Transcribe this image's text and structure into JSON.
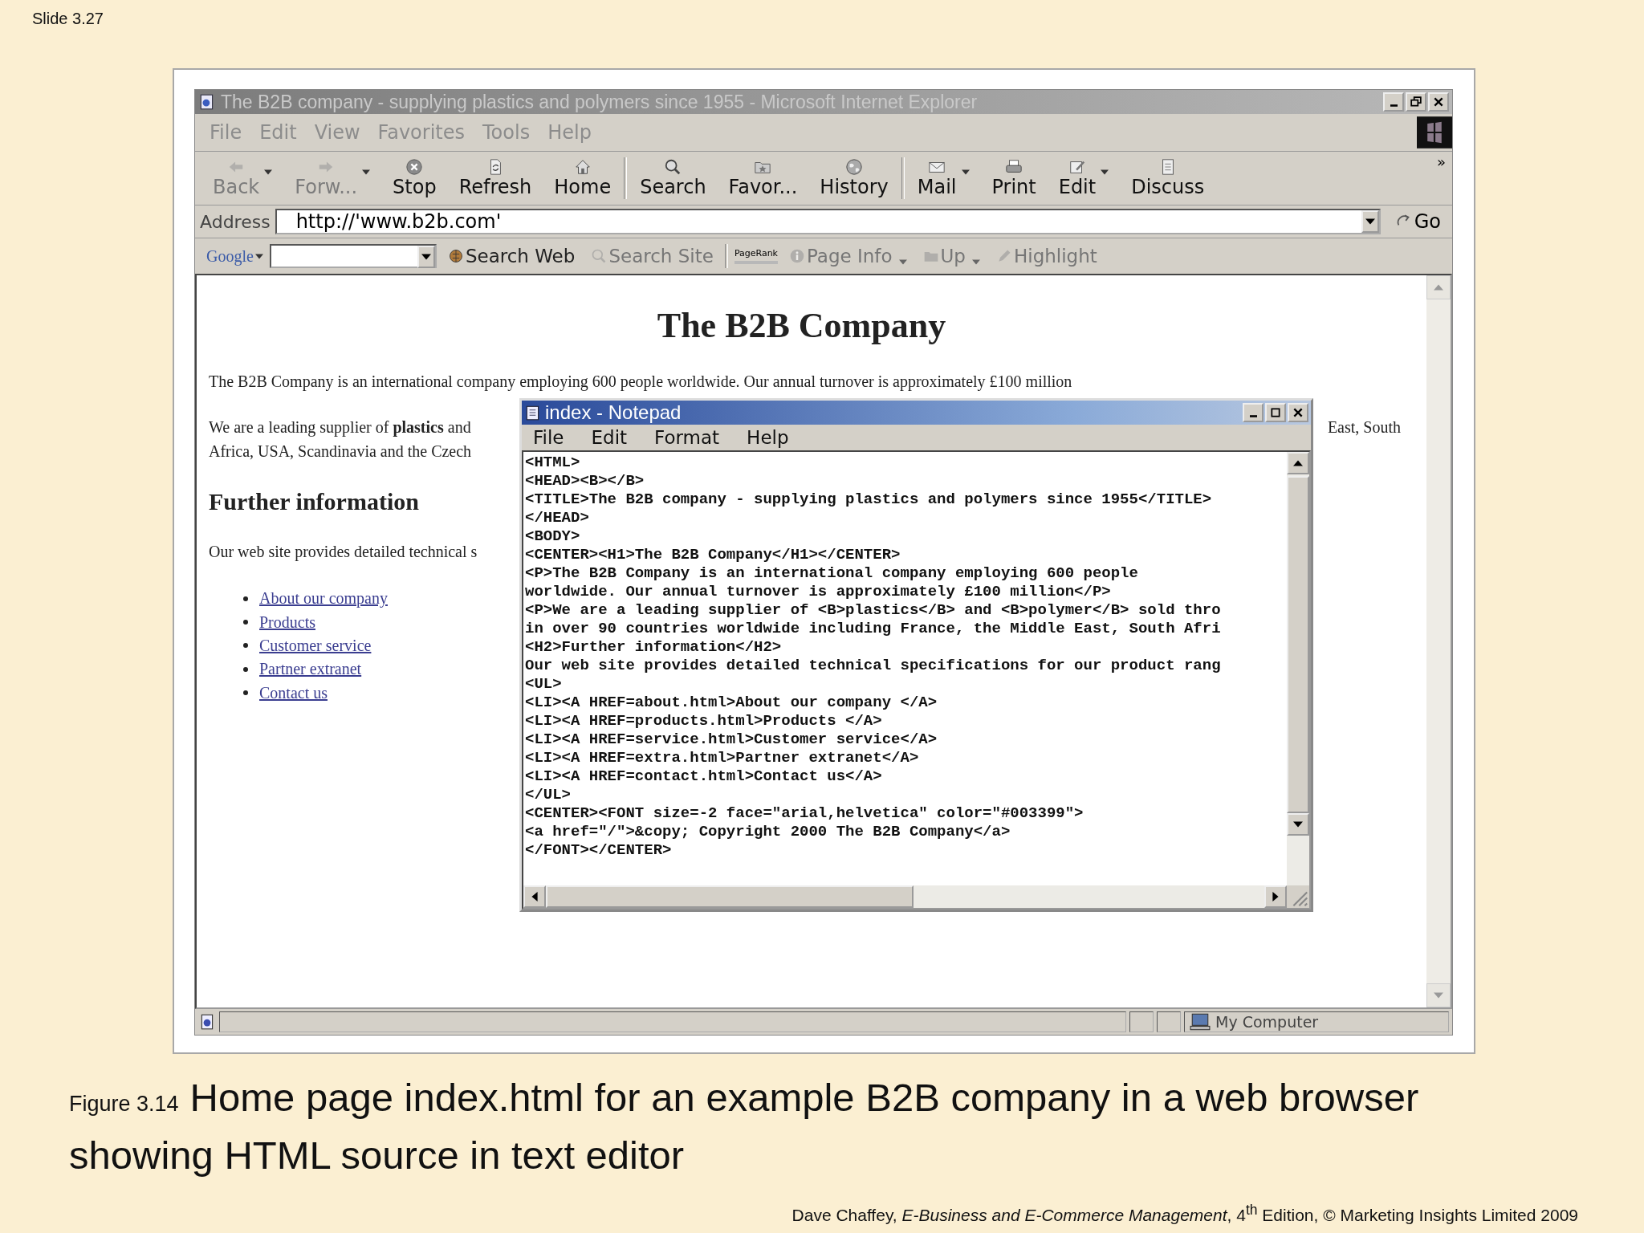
{
  "slide_label": "Slide 3.27",
  "browser": {
    "title": "The B2B company - supplying plastics and polymers since 1955 - Microsoft Internet Explorer",
    "menu": [
      "File",
      "Edit",
      "View",
      "Favorites",
      "Tools",
      "Help"
    ],
    "toolbar_groups": [
      [
        {
          "label": "Back",
          "disabled": true,
          "dropdown": true
        },
        {
          "label": "Forw...",
          "disabled": true,
          "dropdown": true
        },
        {
          "label": "Stop",
          "disabled": false,
          "dropdown": false
        },
        {
          "label": "Refresh",
          "disabled": false,
          "dropdown": false
        },
        {
          "label": "Home",
          "disabled": false,
          "dropdown": false
        }
      ],
      [
        {
          "label": "Search",
          "disabled": false,
          "dropdown": false
        },
        {
          "label": "Favor...",
          "disabled": false,
          "dropdown": false
        },
        {
          "label": "History",
          "disabled": false,
          "dropdown": false
        }
      ],
      [
        {
          "label": "Mail",
          "disabled": false,
          "dropdown": true
        },
        {
          "label": "Print",
          "disabled": false,
          "dropdown": false
        },
        {
          "label": "Edit",
          "disabled": false,
          "dropdown": true
        },
        {
          "label": "Discuss",
          "disabled": false,
          "dropdown": false
        }
      ]
    ],
    "toolbar_more": "»",
    "address": {
      "label": "Address",
      "value": "http://'www.b2b.com'",
      "go": "Go"
    },
    "google_bar": {
      "logo": "Google",
      "search_buttons": [
        {
          "label": "Search Web",
          "disabled": false
        },
        {
          "label": "Search Site",
          "disabled": true
        }
      ],
      "pagerank": "PageRank",
      "tools": [
        {
          "label": "Page Info",
          "disabled": true,
          "dropdown": true
        },
        {
          "label": "Up",
          "disabled": true,
          "dropdown": true
        },
        {
          "label": "Highlight",
          "disabled": true,
          "dropdown": false
        }
      ]
    },
    "page": {
      "heading": "The B2B Company",
      "intro": "The B2B Company is an international company employing 600 people worldwide. Our annual turnover is approximately £100 million",
      "supplier_lines": [
        "We are a leading supplier of **plastics** and",
        "Africa, USA, Scandinavia and the Czech"
      ],
      "supplier_right": "East, South",
      "subheading": "Further information",
      "details": "Our web site provides detailed technical s",
      "links": [
        "About our company",
        "Products",
        "Customer service",
        "Partner extranet",
        "Contact us"
      ]
    },
    "status_bar": {
      "zone": "My Computer"
    }
  },
  "notepad": {
    "title": "index - Notepad",
    "menu": [
      "File",
      "Edit",
      "Format",
      "Help"
    ],
    "lines": [
      "<HTML>",
      "<HEAD><B></B>",
      "<TITLE>The B2B company - supplying plastics and polymers since 1955</TITLE>",
      "</HEAD>",
      "<BODY>",
      "<CENTER><H1>The B2B Company</H1></CENTER>",
      "<P>The B2B Company is an international company employing 600 people",
      "worldwide. Our annual turnover is approximately £100 million</P>",
      "<P>We are a leading supplier of <B>plastics</B> and <B>polymer</B> sold thro",
      "in over 90 countries worldwide including France, the Middle East, South Afri",
      "<H2>Further information</H2>",
      "Our web site provides detailed technical specifications for our product rang",
      "<UL>",
      "<LI><A HREF=about.html>About our company </A>",
      "<LI><A HREF=products.html>Products </A>",
      "<LI><A HREF=service.html>Customer service</A>",
      "<LI><A HREF=extra.html>Partner extranet</A>",
      "<LI><A HREF=contact.html>Contact us</A>",
      "</UL>",
      "<CENTER><FONT size=-2 face=\"arial,helvetica\" color=\"#003399\">",
      "<a href=\"/\">&copy; Copyright 2000 The B2B Company</a>",
      "</FONT></CENTER>"
    ]
  },
  "caption": {
    "figure": "Figure 3.14",
    "text": "Home page index.html for an example B2B company in a web browser showing HTML source in text editor"
  },
  "credit": "Dave Chaffey, *E-Business and E-Commerce Management*, 4$^{th}$ Edition, © Marketing Insights Limited 2009"
}
